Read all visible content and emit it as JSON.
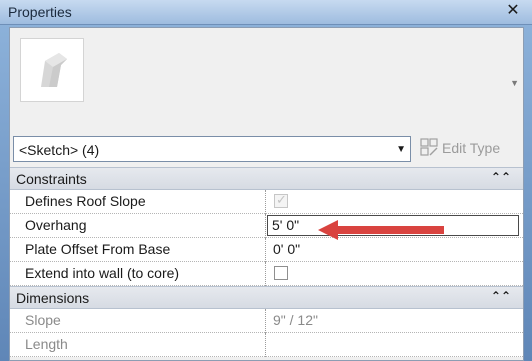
{
  "window": {
    "title": "Properties",
    "close_glyph": "✕"
  },
  "type_selector": {
    "value": "<Sketch> (4)",
    "edit_type_label": "Edit Type"
  },
  "groups": [
    {
      "label": "Constraints",
      "collapse_glyph": "⌃",
      "rows": [
        {
          "name": "Defines Roof Slope",
          "kind": "checkbox",
          "checked": true,
          "enabled": false
        },
        {
          "name": "Overhang",
          "kind": "input",
          "value": "5'  0\""
        },
        {
          "name": "Plate Offset From Base",
          "kind": "text",
          "value": "0'  0\""
        },
        {
          "name": "Extend into wall (to core)",
          "kind": "checkbox",
          "checked": false,
          "enabled": true
        }
      ]
    },
    {
      "label": "Dimensions",
      "collapse_glyph": "⌃",
      "rows": [
        {
          "name": "Slope",
          "kind": "text",
          "value": "9\" / 12\"",
          "dim": true
        },
        {
          "name": "Length",
          "kind": "text",
          "value": "",
          "dim": true
        }
      ]
    }
  ],
  "colors": {
    "annotation_arrow": "#d9433f",
    "titlebar": "#b3cbe8",
    "panel": "#f0f0f0"
  },
  "icons": [
    "close-icon",
    "roof-type-preview-icon",
    "dropdown-arrow-icon",
    "edit-type-icon",
    "collapse-icon",
    "checkbox-icon",
    "annotation-arrow"
  ]
}
